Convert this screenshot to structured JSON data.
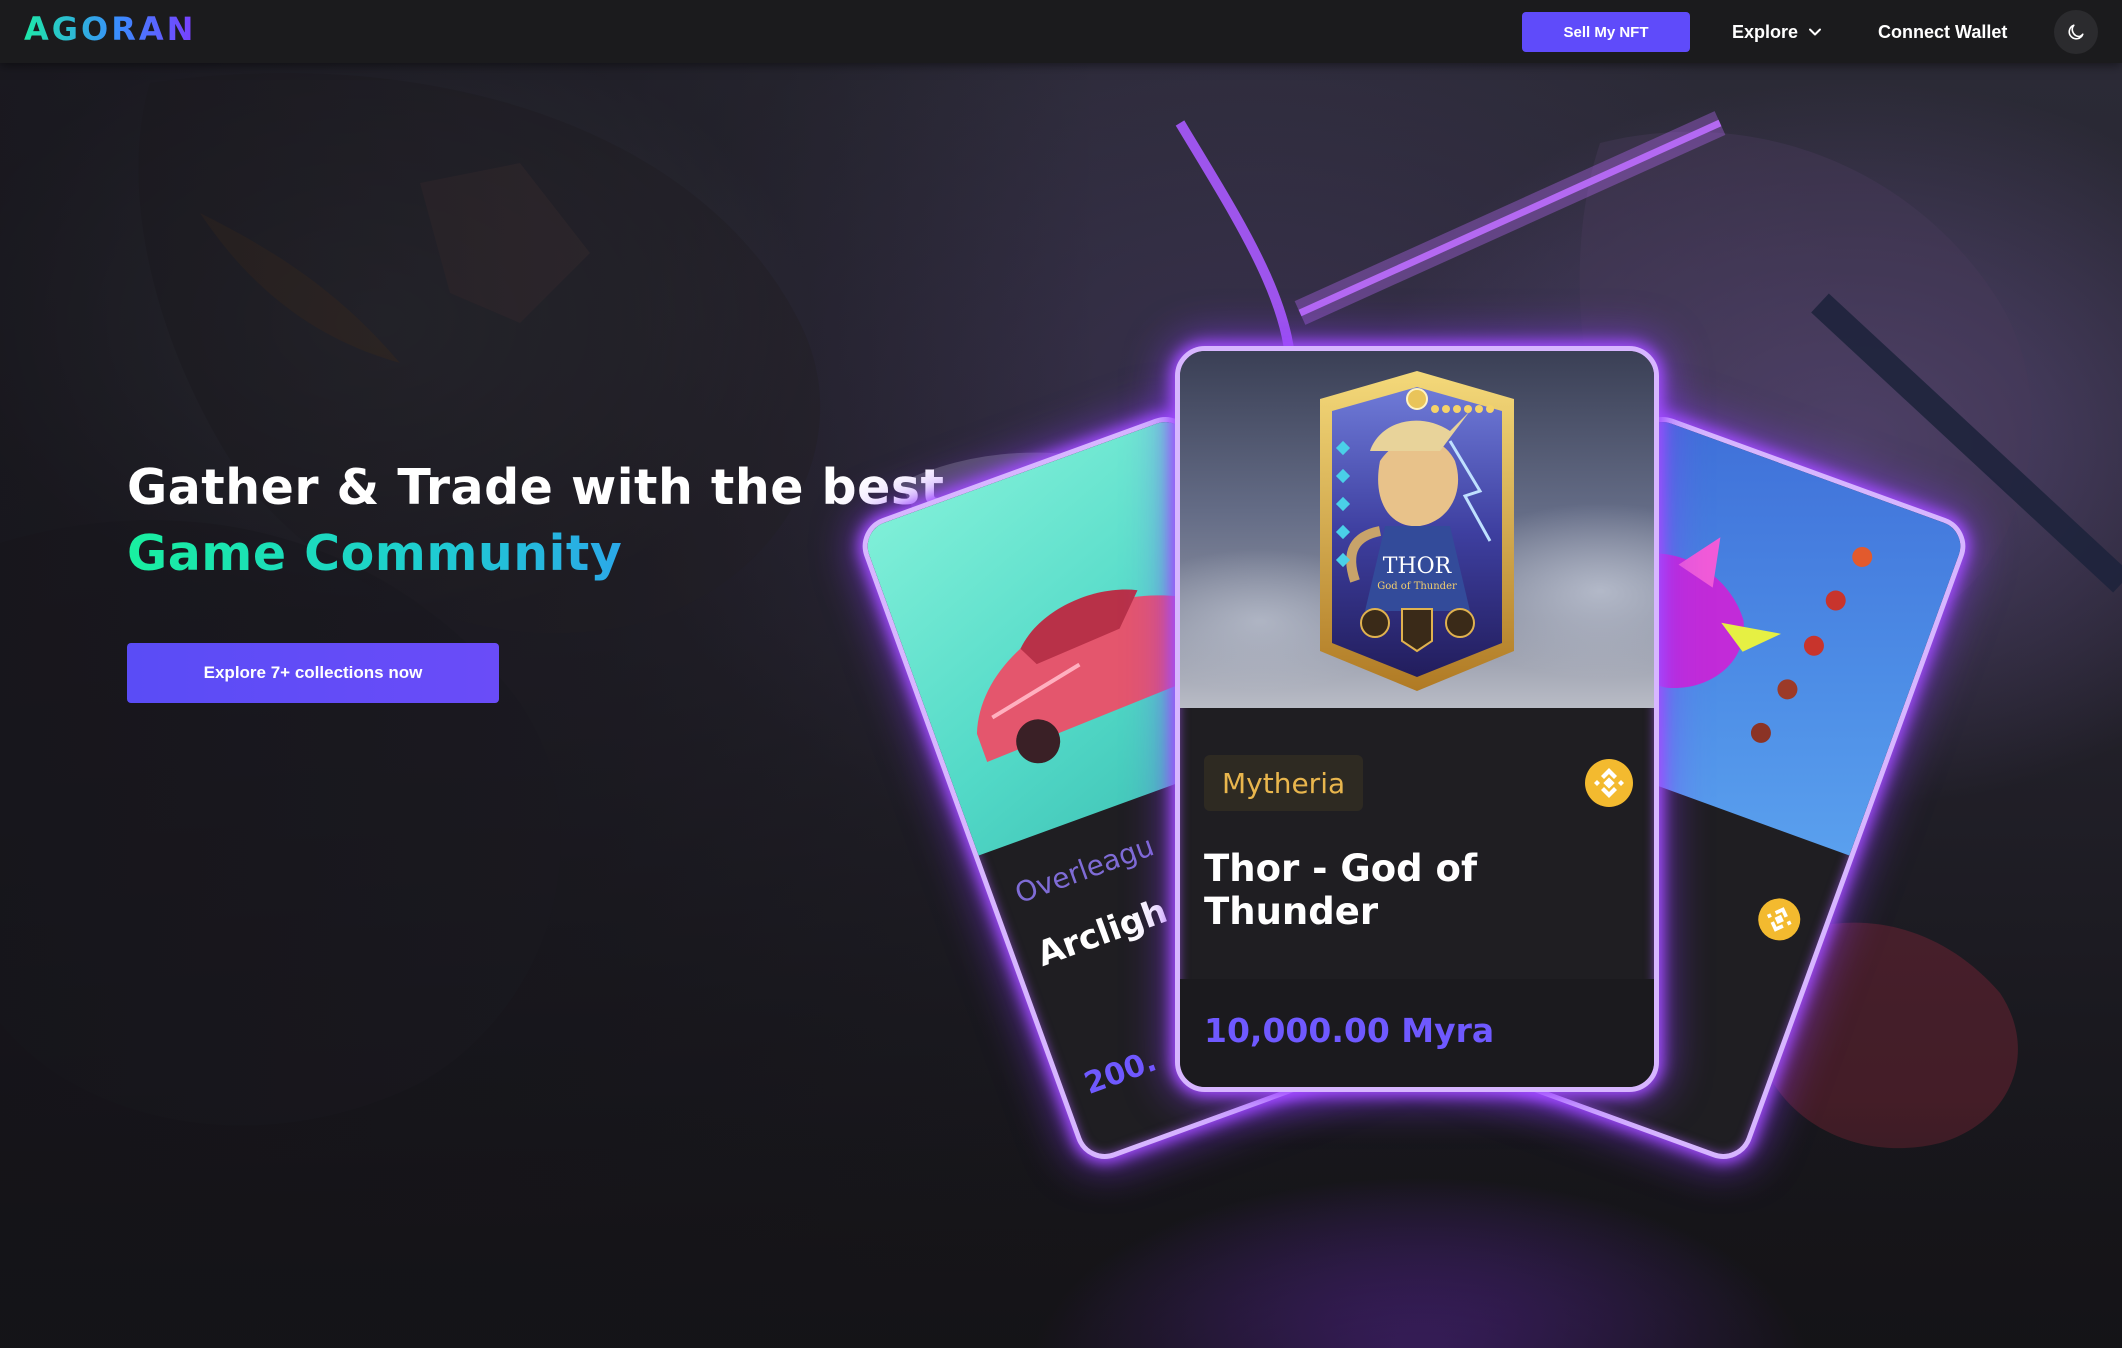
{
  "brand": {
    "logo_text": "AGORAN"
  },
  "navbar": {
    "sell_label": "Sell My NFT",
    "explore_label": "Explore",
    "connect_label": "Connect Wallet"
  },
  "hero": {
    "headline_line1": "Gather & Trade with the best",
    "headline_line2": "Game Community",
    "cta_label": "Explore 7+ collections now"
  },
  "cards": {
    "center": {
      "collection": "Mytheria",
      "title": "Thor - God of Thunder",
      "price": "10,000.00 Myra",
      "art_title": "THOR",
      "art_subtitle": "God of Thunder"
    },
    "left": {
      "collection": "Overleagu",
      "title": "Arcligh",
      "price": "200."
    }
  },
  "colors": {
    "accent": "#5f4bfa",
    "glow": "#a34dff",
    "green_gradient": "#19f0a0",
    "collection_tag": "#e9b64d",
    "price": "#6f59ff"
  },
  "icons": [
    "chevron-down-icon",
    "moon-icon",
    "binance-icon"
  ]
}
